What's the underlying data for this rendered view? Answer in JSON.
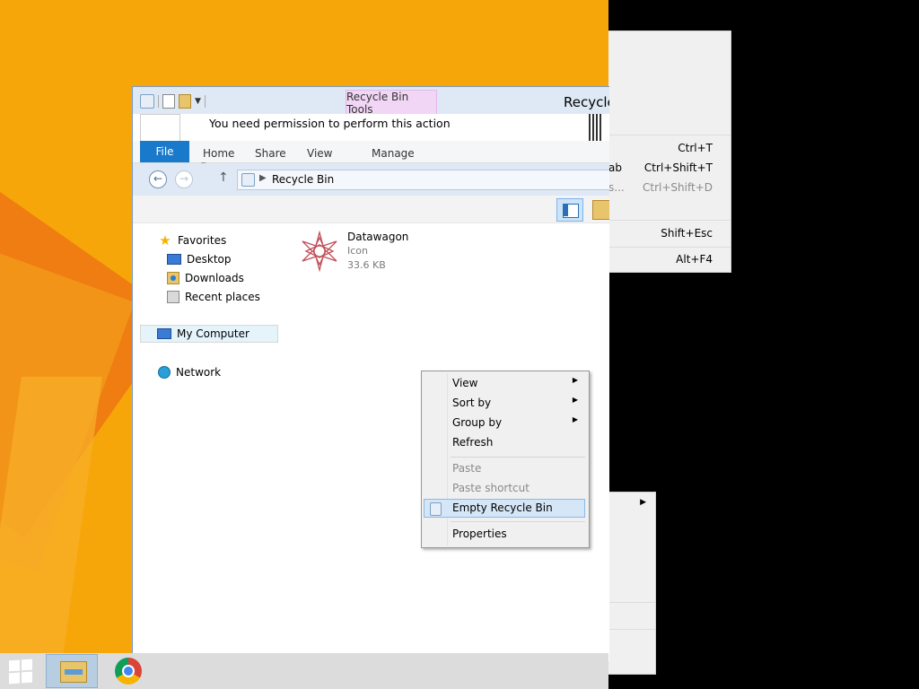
{
  "window": {
    "title": "Recycle",
    "contextual_tab": "Recycle Bin Tools",
    "permission_message": "You need permission to perform this action"
  },
  "ribbon": {
    "tabs": [
      "File",
      "Home",
      "Share",
      "View",
      "Manage"
    ]
  },
  "address": {
    "location": "Recycle Bin"
  },
  "nav_pane": {
    "favorites": "Favorites",
    "favorites_items": [
      "Desktop",
      "Downloads",
      "Recent places"
    ],
    "computer": "My Computer",
    "network": "Network"
  },
  "files": [
    {
      "name": "Datawagon",
      "type": "Icon",
      "size": "33.6 KB"
    }
  ],
  "context_menu": {
    "items": [
      {
        "label": "View",
        "submenu": true,
        "disabled": false
      },
      {
        "label": "Sort by",
        "submenu": true,
        "disabled": false
      },
      {
        "label": "Group by",
        "submenu": true,
        "disabled": false
      },
      {
        "label": "Refresh",
        "submenu": false,
        "disabled": false
      },
      {
        "label": "Paste",
        "submenu": false,
        "disabled": true
      },
      {
        "label": "Paste shortcut",
        "submenu": false,
        "disabled": true
      },
      {
        "label": "Empty Recycle Bin",
        "submenu": false,
        "disabled": false,
        "highlighted": true
      },
      {
        "label": "Properties",
        "submenu": false,
        "disabled": false
      }
    ]
  },
  "background_menu": {
    "shortcuts": [
      "Ctrl+T",
      "Ctrl+Shift+T",
      "Ctrl+Shift+D",
      "Shift+Esc",
      "Alt+F4"
    ],
    "fragments": [
      "ab",
      "s..."
    ]
  },
  "taskbar": {
    "apps": [
      "start-button",
      "file-explorer",
      "chrome"
    ]
  },
  "colors": {
    "desktop_bg": "#f6a609",
    "file_tab": "#1979ca",
    "contextual_tab": "#f1d6f5",
    "menu_highlight": "#d5e6f7"
  }
}
